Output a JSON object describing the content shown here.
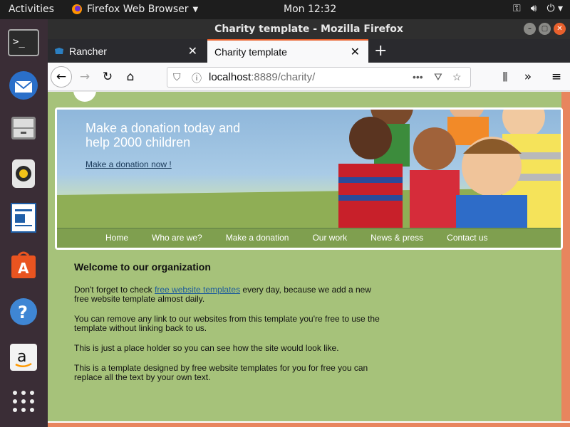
{
  "topbar": {
    "activities": "Activities",
    "app_name": "Firefox Web Browser",
    "clock": "Mon 12:32"
  },
  "dock": {
    "items": [
      "terminal-icon",
      "thunderbird-icon",
      "files-icon",
      "rhythmbox-icon",
      "writer-icon",
      "software-icon",
      "help-icon",
      "amazon-icon",
      "apps-grid-icon"
    ]
  },
  "window": {
    "title": "Charity template - Mozilla Firefox"
  },
  "tabs": [
    {
      "label": "Rancher"
    },
    {
      "label": "Charity template"
    }
  ],
  "urlbar": {
    "host": "localhost",
    "rest": ":8889/charity/"
  },
  "page": {
    "hero_title": "Make a donation today and help 2000 children",
    "hero_link": "Make a donation now !",
    "nav": [
      "Home",
      "Who are we?",
      "Make a donation",
      "Our work",
      "News & press",
      "Contact us"
    ],
    "heading": "Welcome to our organization",
    "p1_before": "Don't forget to check ",
    "p1_link": "free website templates",
    "p1_after": " every day, because we add a new free website template almost daily.",
    "p2": "You can remove any link to our websites from this template you're free to use the template without linking back to us.",
    "p3": "This is just a place holder so you can see how the site would look like.",
    "p4": "This is a template designed by free website templates for you for free you can replace all the text by your own text."
  },
  "colors": {
    "page_bg": "#a6c27a",
    "nav_bg": "#7f9f4f",
    "accent": "#e8855e"
  }
}
